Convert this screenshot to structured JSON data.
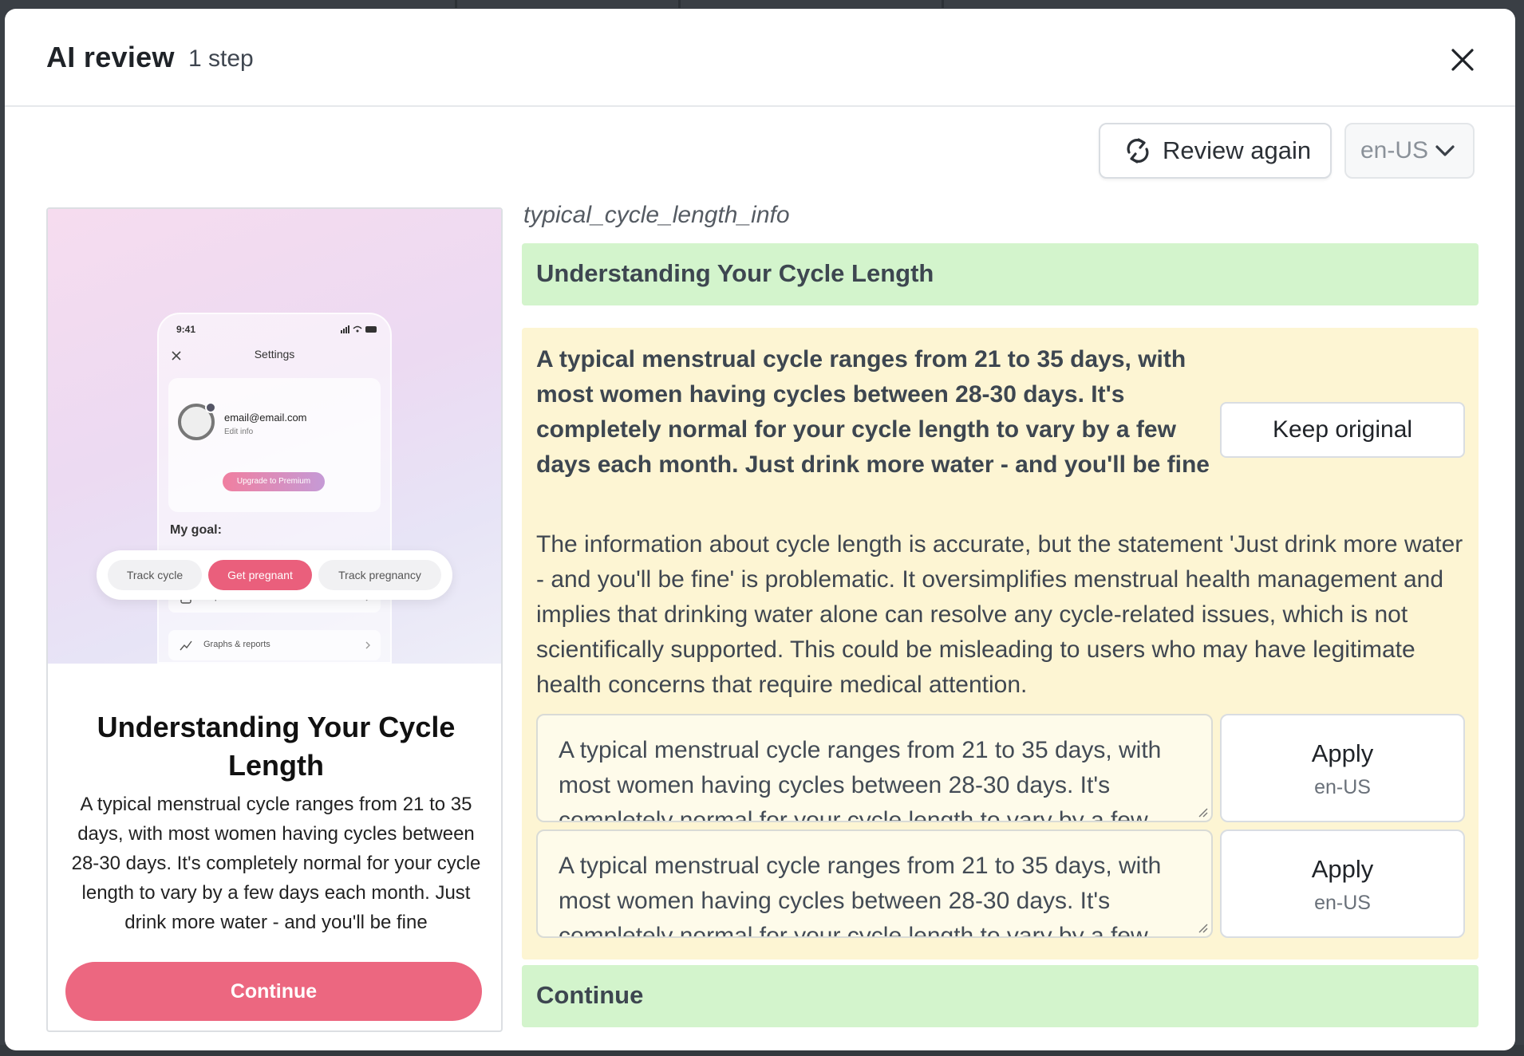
{
  "modal": {
    "title": "AI review",
    "subtitle": "1 step"
  },
  "toolbar": {
    "review_again_label": "Review again",
    "language_selected": "en-US"
  },
  "preview": {
    "phone": {
      "time": "9:41",
      "settings_title": "Settings",
      "email": "email@email.com",
      "edit_info": "Edit info",
      "premium_label": "Upgrade to Premium",
      "goal_label": "My goal:",
      "goals": [
        "Track cycle",
        "Get pregnant",
        "Track pregnancy"
      ],
      "rows": [
        "Report for a doctor",
        "Graphs & reports"
      ]
    },
    "title": "Understanding Your Cycle Length",
    "body": "A typical menstrual cycle ranges from 21 to 35 days, with most women having cycles between 28-30 days. It's completely normal for your cycle length to vary by a few days each month. Just drink more water - and you'll be fine",
    "continue_label": "Continue"
  },
  "review": {
    "key": "typical_cycle_length_info",
    "title_item": "Understanding Your Cycle Length",
    "original_text": "A typical menstrual cycle ranges from 21 to 35 days, with most women having cycles between 28-30 days. It's completely normal for your cycle length to vary by a few days each month. Just drink more water - and you'll be fine",
    "keep_original_label": "Keep original",
    "reason": "The information about cycle length is accurate, but the statement 'Just drink more water - and you'll be fine' is problematic. It oversimplifies menstrual health management and implies that drinking water alone can resolve any cycle-related issues, which is not scientifically supported. This could be misleading to users who may have legitimate health concerns that require medical attention.",
    "suggestions": [
      {
        "text": "A typical menstrual cycle ranges from 21 to 35 days, with most women having cycles between 28-30 days. It's completely normal for your cycle length to vary by a few days each month.",
        "apply_label": "Apply",
        "apply_lang": "en-US"
      },
      {
        "text": "A typical menstrual cycle ranges from 21 to 35 days, with most women having cycles between 28-30 days. It's completely normal for your cycle length to vary by a few days each month.",
        "apply_label": "Apply",
        "apply_lang": "en-US"
      }
    ],
    "continue_item": "Continue"
  },
  "colors": {
    "accent_pink": "#ec6780",
    "ok_green": "#d3f4cc",
    "flag_yellow": "#fdf5d3"
  },
  "icons": [
    "close-icon",
    "refresh-icon",
    "chevron-down-icon",
    "resize-grip-icon"
  ]
}
